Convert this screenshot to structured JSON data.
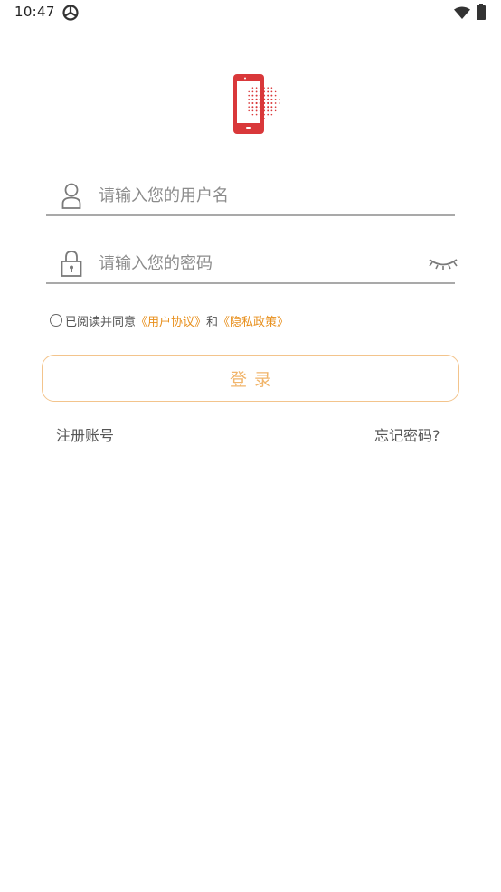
{
  "status_bar": {
    "time": "10:47"
  },
  "login_form": {
    "username_placeholder": "请输入您的用户名",
    "password_placeholder": "请输入您的密码",
    "agreement": {
      "prefix": "已阅读并同意",
      "user_agreement": "《用户协议》",
      "connector": "和",
      "privacy_policy": "《隐私政策》"
    },
    "login_label": "登录",
    "register_label": "注册账号",
    "forgot_label": "忘记密码?"
  },
  "colors": {
    "logo_red": "#d9383a",
    "accent_orange": "#e8901e",
    "button_border": "#f3c48c",
    "button_text": "#f1b56b"
  },
  "icons": {
    "app_status": "app-status-icon",
    "wifi": "wifi-icon",
    "battery": "battery-icon",
    "logo": "phone-logo-icon",
    "user": "user-icon",
    "lock": "lock-icon",
    "eye": "eye-closed-icon"
  }
}
